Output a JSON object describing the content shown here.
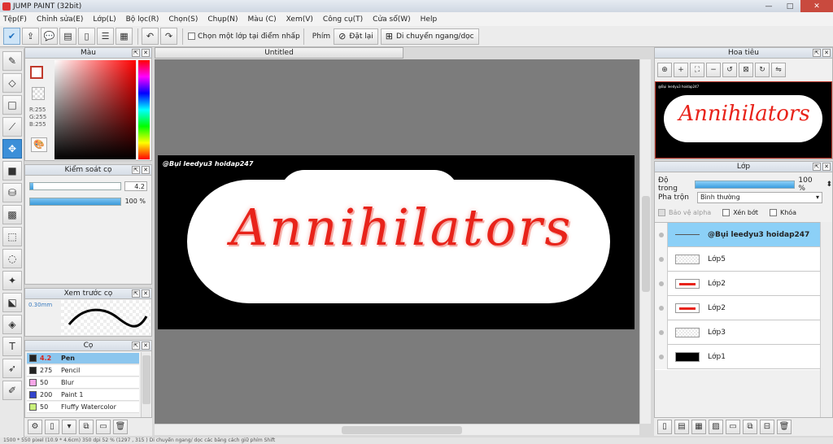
{
  "window": {
    "title": "JUMP PAINT (32bit)",
    "minimize": "—",
    "maximize": "□",
    "close": "✕"
  },
  "menu": [
    "Tệp(F)",
    "Chỉnh sửa(E)",
    "Lớp(L)",
    "Bộ lọc(R)",
    "Chọn(S)",
    "Chụp(N)",
    "Màu (C)",
    "Xem(V)",
    "Công cụ(T)",
    "Cửa sổ(W)",
    "Help"
  ],
  "toolbar": {
    "select_one_layer": "Chọn một lớp tại điểm nhấp",
    "keys_label": "Phím",
    "reset_label": "Đặt lại",
    "move_hv_label": "Di chuyển ngang/dọc"
  },
  "panels": {
    "color": {
      "title": "Màu",
      "r": "R:255",
      "g": "G:255",
      "b": "B:255"
    },
    "brush_control": {
      "title": "Kiểm soát cọ",
      "size_value": "4.2",
      "size_fill": 0.04,
      "opacity_value": "100 %",
      "opacity_fill": 1.0
    },
    "brush_preview": {
      "title": "Xem trước cọ",
      "size": "0.30mm"
    },
    "brush_list": {
      "title": "Cọ",
      "items": [
        {
          "size": "4.2",
          "name": "Pen",
          "color": "#222222",
          "selected": true
        },
        {
          "size": "275",
          "name": "Pencil",
          "color": "#222222",
          "selected": false
        },
        {
          "size": "50",
          "name": "Blur",
          "color": "#f7a6e8",
          "selected": false
        },
        {
          "size": "200",
          "name": "Paint 1",
          "color": "#3344cc",
          "selected": false
        },
        {
          "size": "50",
          "name": "Fluffy Watercolor",
          "color": "#c9ef7a",
          "selected": false
        }
      ]
    },
    "navigator": {
      "title": "Hoa tiêu"
    },
    "layers": {
      "title": "Lớp",
      "opacity_label": "Độ trong",
      "opacity_value": "100 %",
      "blend_label": "Pha trộn",
      "blend_value": "Bình thường",
      "protect_alpha": "Bảo vệ alpha",
      "clipping": "Xén bớt",
      "lock": "Khóa",
      "items": [
        {
          "name": "@Bụi leedyu3 hoidap247",
          "thumb": "line",
          "selected": true
        },
        {
          "name": "Lớp5",
          "thumb": "empty",
          "selected": false
        },
        {
          "name": "Lớp2",
          "thumb": "art",
          "selected": false
        },
        {
          "name": "Lớp2",
          "thumb": "art",
          "selected": false
        },
        {
          "name": "Lớp3",
          "thumb": "empty",
          "selected": false
        },
        {
          "name": "Lớp1",
          "thumb": "black",
          "selected": false
        }
      ]
    }
  },
  "document": {
    "tab": "Untitled",
    "credit": "@Bụi leedyu3 hoidap247",
    "artwork_text": "Annihilators"
  },
  "status": "1500 * 550 pixel   (10.9 * 4.6cm)   350 dpi   52 %   (1297 , 315 )   Di chuyển ngang/ dọc các bằng cách giữ phím Shift"
}
